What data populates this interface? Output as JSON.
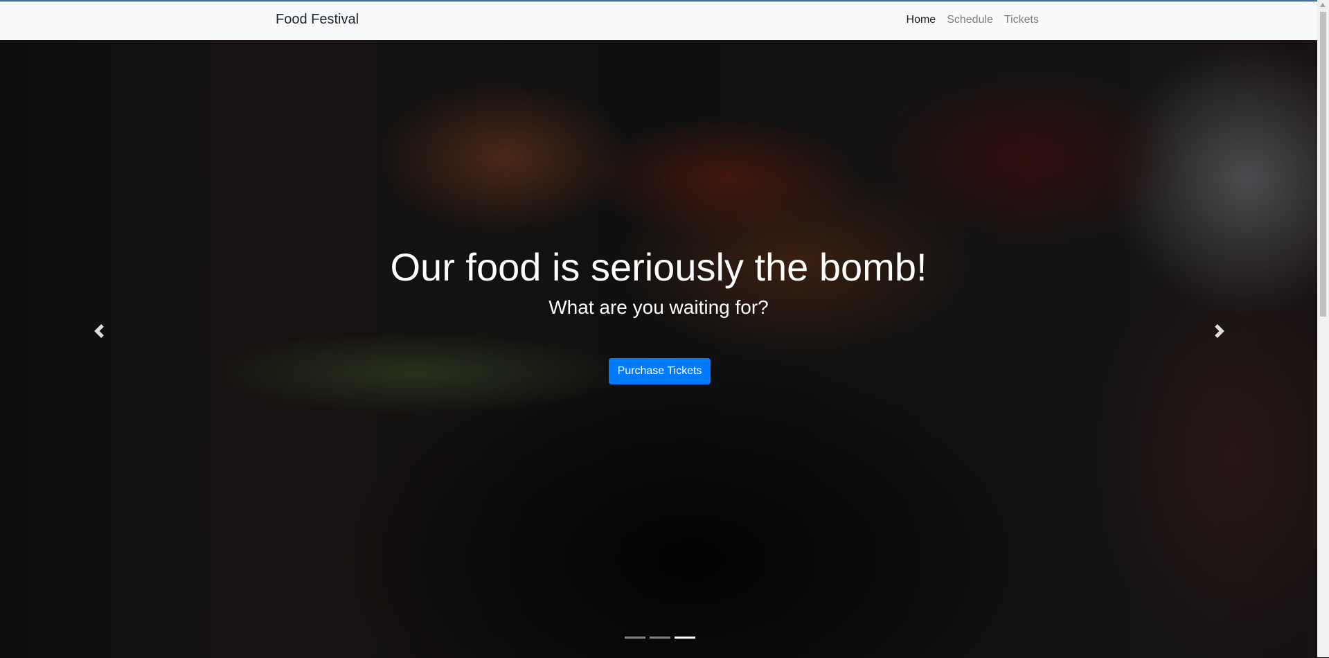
{
  "navbar": {
    "brand": "Food Festival",
    "links": [
      {
        "label": "Home",
        "active": true
      },
      {
        "label": "Schedule"
      },
      {
        "label": "Tickets"
      }
    ]
  },
  "hero": {
    "title": "Our food is seriously the bomb!",
    "subtitle": "What are you waiting for?",
    "cta": "Purchase Tickets",
    "slides": 3,
    "active_slide": 3
  },
  "colors": {
    "accent": "#007bff",
    "navbar_bg": "#f8f9fa"
  }
}
